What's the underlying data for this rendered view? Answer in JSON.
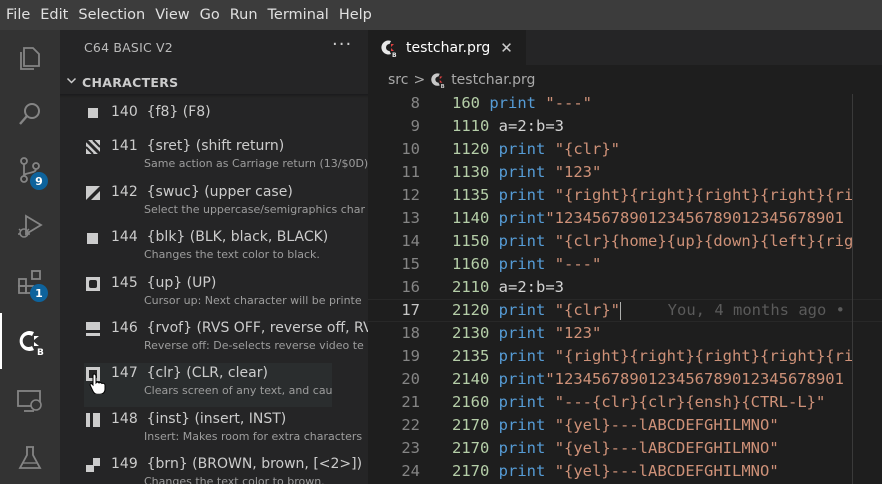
{
  "menu": [
    "File",
    "Edit",
    "Selection",
    "View",
    "Go",
    "Run",
    "Terminal",
    "Help"
  ],
  "activity_bar": {
    "items": [
      "explorer-icon",
      "search-icon",
      "source-control-icon",
      "run-debug-icon",
      "extensions-icon",
      "c64-basic-icon",
      "remote-explorer-icon",
      "testing-icon"
    ],
    "badges": {
      "source_control": "9",
      "extensions": "1"
    }
  },
  "sidebar": {
    "title": "C64 BASIC V2",
    "more": "···",
    "section": "CHARACTERS",
    "items": [
      {
        "code": "140",
        "name": "{f8} (F8)",
        "desc": ""
      },
      {
        "code": "141",
        "name": "{sret} (shift return)",
        "desc": "Same action as Carriage return (13/$0D)"
      },
      {
        "code": "142",
        "name": "{swuc} (upper case)",
        "desc": "Select the uppercase/semigraphics char"
      },
      {
        "code": "144",
        "name": "{blk} (BLK, black, BLACK)",
        "desc": "Changes the text color to black."
      },
      {
        "code": "145",
        "name": "{up} (UP)",
        "desc": "Cursor up: Next character will be printe"
      },
      {
        "code": "146",
        "name": "{rvof} (RVS OFF, reverse off, RV",
        "desc": "Reverse off: De-selects reverse video te"
      },
      {
        "code": "147",
        "name": "{clr} (CLR, clear)",
        "desc": "Clears screen of any text, and causes the"
      },
      {
        "code": "148",
        "name": "{inst} (insert, INST)",
        "desc": "Insert: Makes room for extra characters"
      },
      {
        "code": "149",
        "name": "{brn} (BROWN, brown, [<2>])",
        "desc": "Changes the text color to brown."
      }
    ]
  },
  "editor": {
    "tab": {
      "name": "testchar.prg",
      "close": "✕"
    },
    "breadcrumb": {
      "folder": "src",
      "sep": ">",
      "file": "testchar.prg"
    },
    "blame": "You, 4 months ago •",
    "lines": [
      {
        "n": "8",
        "num": "160",
        "kw": "print",
        "rest": " \"---\""
      },
      {
        "n": "9",
        "num": "1110",
        "kw": "",
        "rest": " a=2:b=3"
      },
      {
        "n": "10",
        "num": "1120",
        "kw": "print",
        "rest": " \"{clr}\""
      },
      {
        "n": "11",
        "num": "1130",
        "kw": "print",
        "rest": " \"123\""
      },
      {
        "n": "12",
        "num": "1135",
        "kw": "print",
        "rest": " \"{right}{right}{right}{right}{ri"
      },
      {
        "n": "13",
        "num": "1140",
        "kw": "print",
        "rest": "\"1234567890123456789012345678901"
      },
      {
        "n": "14",
        "num": "1150",
        "kw": "print",
        "rest": " \"{clr}{home}{up}{down}{left}{rig"
      },
      {
        "n": "15",
        "num": "1160",
        "kw": "print",
        "rest": " \"---\""
      },
      {
        "n": "16",
        "num": "2110",
        "kw": "",
        "rest": " a=2:b=3"
      },
      {
        "n": "17",
        "num": "2120",
        "kw": "print",
        "rest": " \"{clr}\""
      },
      {
        "n": "18",
        "num": "2130",
        "kw": "print",
        "rest": " \"123\""
      },
      {
        "n": "19",
        "num": "2135",
        "kw": "print",
        "rest": " \"{right}{right}{right}{right}{ri"
      },
      {
        "n": "20",
        "num": "2140",
        "kw": "print",
        "rest": "\"1234567890123456789012345678901"
      },
      {
        "n": "21",
        "num": "2160",
        "kw": "print",
        "rest": " \"---{clr}{clr}{ensh}{CTRL-L}\""
      },
      {
        "n": "22",
        "num": "2170",
        "kw": "print",
        "rest": " \"{yel}---lABCDEFGHILMNO\""
      },
      {
        "n": "23",
        "num": "2170",
        "kw": "print",
        "rest": " \"{yel}---lABCDEFGHILMNO\""
      },
      {
        "n": "24",
        "num": "2170",
        "kw": "print",
        "rest": " \"{yel}---lABCDEFGHILMNO\""
      }
    ]
  },
  "colors": {
    "accent": "#0e639c",
    "keyword": "#569cd6",
    "string": "#ce9178",
    "number": "#b5cea8"
  }
}
